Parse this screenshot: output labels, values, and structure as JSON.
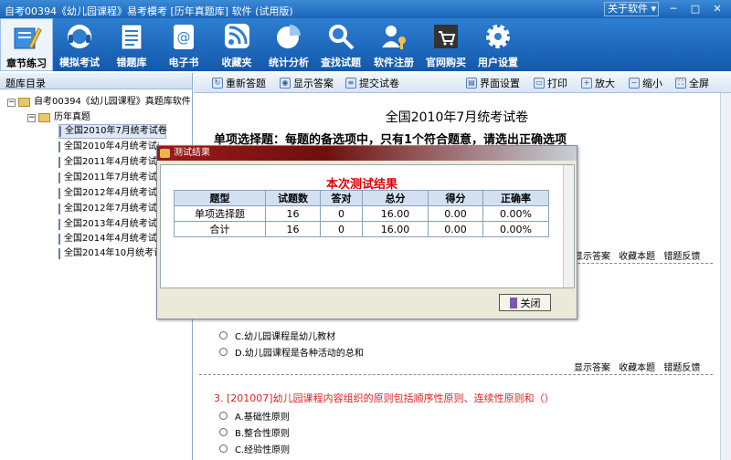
{
  "window": {
    "title": "自考00394《幼儿园课程》易考模考 [历年真题库] 软件 (试用版)",
    "about": "关于软件 ▾",
    "minimize": "─",
    "restore": "□",
    "close": "✕"
  },
  "toolbar": {
    "items": [
      {
        "label": "章节练习",
        "icon": "pencil-book-icon"
      },
      {
        "label": "模拟考试",
        "icon": "headset-icon"
      },
      {
        "label": "错题库",
        "icon": "list-icon"
      },
      {
        "label": "电子书",
        "icon": "ebook-icon"
      },
      {
        "label": "收藏夹",
        "icon": "rss-icon"
      },
      {
        "label": "统计分析",
        "icon": "pie-chart-icon"
      },
      {
        "label": "查找试题",
        "icon": "magnifier-icon"
      },
      {
        "label": "软件注册",
        "icon": "user-key-icon"
      },
      {
        "label": "官网购买",
        "icon": "cart-icon"
      },
      {
        "label": "用户设置",
        "icon": "gear-icon"
      }
    ]
  },
  "sidebar": {
    "header": "题库目录",
    "root": "自考00394《幼儿园课程》真题库软件",
    "folder": "历年真题",
    "items": [
      "全国2010年7月统考试卷",
      "全国2010年4月统考试卷",
      "全国2011年4月统考试卷",
      "全国2011年7月统考试卷",
      "全国2012年4月统考试卷",
      "全国2012年7月统考试卷",
      "全国2013年4月统考试卷",
      "全国2014年4月统考试卷",
      "全国2014年10月统考试卷"
    ]
  },
  "actions": {
    "redo": "重新答题",
    "show_answer": "显示答案",
    "submit": "提交试卷",
    "ui_settings": "界面设置",
    "print": "打印",
    "zoom_in": "放大",
    "zoom_out": "缩小",
    "fullscreen": "全屏"
  },
  "exam": {
    "title": "全国2010年7月统考试卷",
    "section": "单项选择题：每题的备选项中，只有1个符合题意，请选出正确选项",
    "links": "显示答案 收藏本题 错题反馈",
    "q2_options": [
      "C.幼儿园课程是幼儿教材",
      "D.幼儿园课程是各种活动的总和"
    ],
    "q3_text": "3. [201007]幼儿园课程内容组织的原则包括顺序性原则、连续性原则和（）",
    "q3_options": [
      "A.基础性原则",
      "B.整合性原则",
      "C.经验性原则"
    ]
  },
  "dialog": {
    "title": "测试结果",
    "heading": "本次测试结果",
    "columns": [
      "题型",
      "试题数",
      "答对",
      "总分",
      "得分",
      "正确率"
    ],
    "rows": [
      [
        "单项选择题",
        "16",
        "0",
        "16.00",
        "0.00",
        "0.00%"
      ],
      [
        "合计",
        "16",
        "0",
        "16.00",
        "0.00",
        "0.00%"
      ]
    ],
    "close": "关闭"
  }
}
